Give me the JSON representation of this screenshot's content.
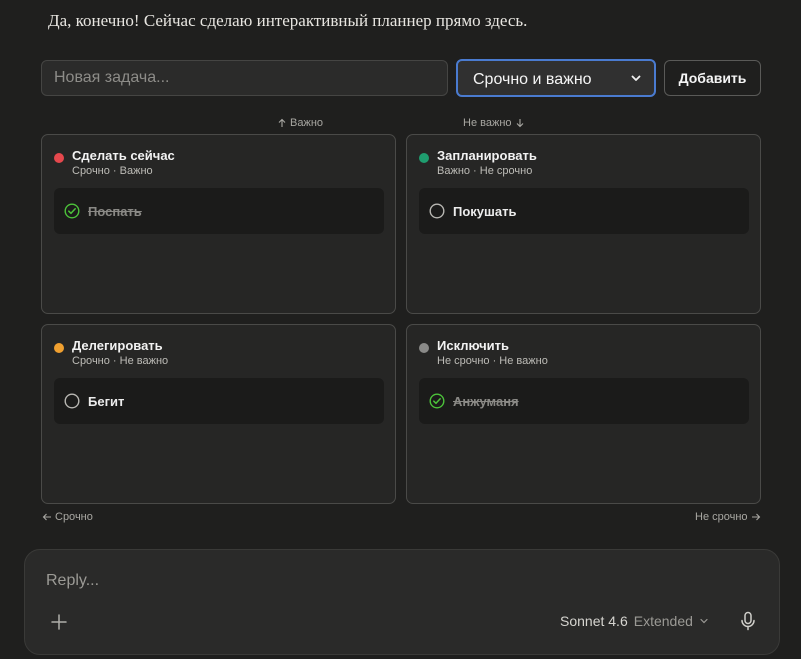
{
  "intro": "Да, конечно! Сейчас сделаю интерактивный планнер прямо здесь.",
  "form": {
    "placeholder": "Новая задача...",
    "priority_selected": "Срочно и важно",
    "add_label": "Добавить"
  },
  "axes": {
    "important": "Важно",
    "not_important": "Не важно",
    "urgent": "Срочно",
    "not_urgent": "Не срочно"
  },
  "quadrants": [
    {
      "title": "Сделать сейчас",
      "subtitle": "Срочно · Важно",
      "color": "#e5484d",
      "task": {
        "label": "Поспать",
        "done": true
      }
    },
    {
      "title": "Запланировать",
      "subtitle": "Важно · Не срочно",
      "color": "#1f9d6f",
      "task": {
        "label": "Покушать",
        "done": false
      }
    },
    {
      "title": "Делегировать",
      "subtitle": "Срочно · Не важно",
      "color": "#f0a030",
      "task": {
        "label": "Бегит",
        "done": false
      }
    },
    {
      "title": "Исключить",
      "subtitle": "Не срочно · Не важно",
      "color": "#8a8a88",
      "task": {
        "label": "Анжуманя",
        "done": true
      }
    }
  ],
  "reply": {
    "placeholder": "Reply...",
    "model_name": "Sonnet 4.6",
    "model_mode": "Extended"
  },
  "colors": {
    "done_check": "#4cc23a",
    "focus_border": "#4a7bd0"
  }
}
